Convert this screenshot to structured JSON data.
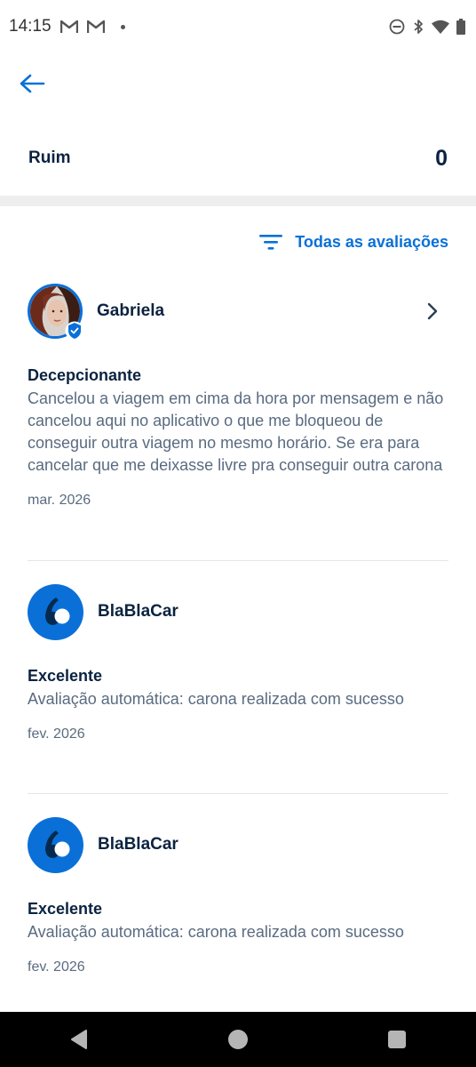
{
  "status_bar": {
    "time": "14:15",
    "icons": [
      "gmail-icon",
      "gmail-icon",
      "dot-icon",
      "do-not-disturb-icon",
      "bluetooth-icon",
      "wifi-icon",
      "battery-icon"
    ]
  },
  "header": {
    "back_icon": "arrow-left-icon"
  },
  "rating_summary": {
    "label": "Ruim",
    "count": "0"
  },
  "filter": {
    "label": "Todas as avaliações",
    "icon": "filter-icon"
  },
  "reviews": [
    {
      "name": "Gabriela",
      "title": "Decepcionante",
      "text": "Cancelou a viagem em cima da hora por mensagem e não cancelou aqui no aplicativo o que me bloqueou de conseguir outra viagem no mesmo horário. Se era para cancelar que me deixasse livre pra conseguir outra carona",
      "date": "mar. 2026"
    },
    {
      "name": "BlaBlaCar",
      "title": "Excelente",
      "text": "Avaliação automática: carona realizada com sucesso",
      "date": "fev. 2026"
    },
    {
      "name": "BlaBlaCar",
      "title": "Excelente",
      "text": "Avaliação automática: carona realizada com sucesso",
      "date": "fev. 2026"
    }
  ],
  "colors": {
    "accent": "#0a70d8",
    "text": "#0b2340",
    "muted": "#5a6b80"
  }
}
